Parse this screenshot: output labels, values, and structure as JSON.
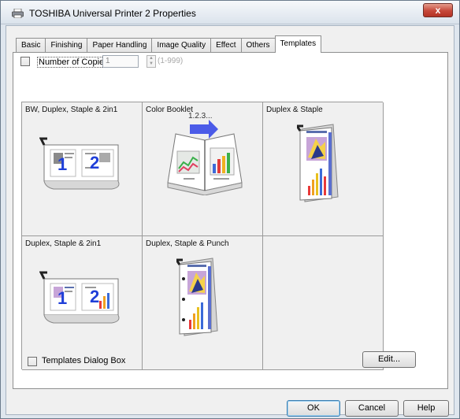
{
  "window": {
    "title": "TOSHIBA Universal Printer 2 Properties",
    "close_label": "x"
  },
  "tabs": [
    {
      "label": "Basic"
    },
    {
      "label": "Finishing"
    },
    {
      "label": "Paper Handling"
    },
    {
      "label": "Image Quality"
    },
    {
      "label": "Effect"
    },
    {
      "label": "Others"
    },
    {
      "label": "Templates",
      "active": true
    }
  ],
  "copies": {
    "label": "Number of Copies",
    "value": "1",
    "range": "(1-999)",
    "checked": false
  },
  "templates": [
    {
      "label": "BW, Duplex, Staple & 2in1",
      "icon": "duplex-2in1-preview-icon"
    },
    {
      "label": "Color Booklet",
      "overlay": "1.2.3...",
      "icon": "booklet-preview-icon"
    },
    {
      "label": "Duplex & Staple",
      "icon": "duplex-staple-preview-icon"
    },
    {
      "label": "Duplex, Staple & 2in1",
      "icon": "duplex-2in1-preview-icon"
    },
    {
      "label": "Duplex, Staple & Punch",
      "icon": "duplex-punch-preview-icon"
    },
    {
      "label": ""
    }
  ],
  "page_numbers": {
    "one": "1",
    "two": "2"
  },
  "dialog_box": {
    "label": "Templates Dialog Box",
    "checked": false
  },
  "buttons": {
    "edit": "Edit...",
    "ok": "OK",
    "cancel": "Cancel",
    "help": "Help"
  }
}
